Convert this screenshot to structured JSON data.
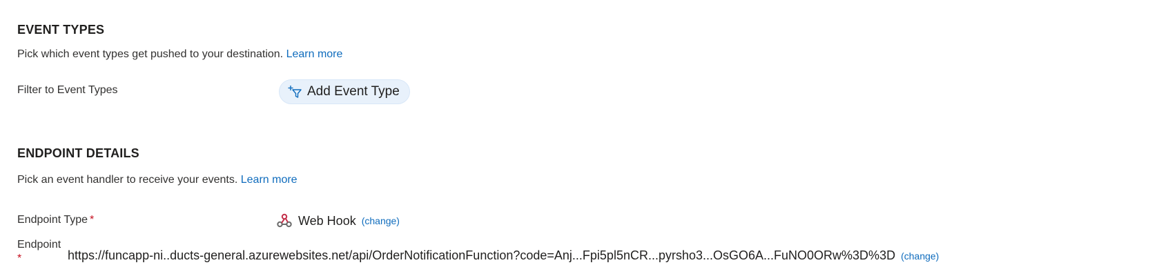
{
  "event_types": {
    "title": "EVENT TYPES",
    "description": "Pick which event types get pushed to your destination.",
    "learn_more": "Learn more",
    "filter_label": "Filter to Event Types",
    "add_button_label": "Add Event Type"
  },
  "endpoint_details": {
    "title": "ENDPOINT DETAILS",
    "description": "Pick an event handler to receive your events.",
    "learn_more": "Learn more",
    "endpoint_type_label": "Endpoint Type",
    "required_marker": "*",
    "endpoint_type_value": "Web Hook",
    "change_label": "(change)",
    "endpoint_label": "Endpoint",
    "endpoint_url": "https://funcapp-ni..ducts-general.azurewebsites.net/api/OrderNotificationFunction?code=Anj...Fpi5pl5nCR...pyrsho3...OsGO6A...FuNO0ORw%3D%3D",
    "endpoint_change_label": "(change)"
  },
  "colors": {
    "accent": "#0f6cbd",
    "required": "#c50f1f",
    "pill_bg": "#e8f1fb",
    "webhook_icon": "#c4314b"
  },
  "icons": {
    "add_filter": "filter-add-icon",
    "webhook": "webhook-icon"
  }
}
